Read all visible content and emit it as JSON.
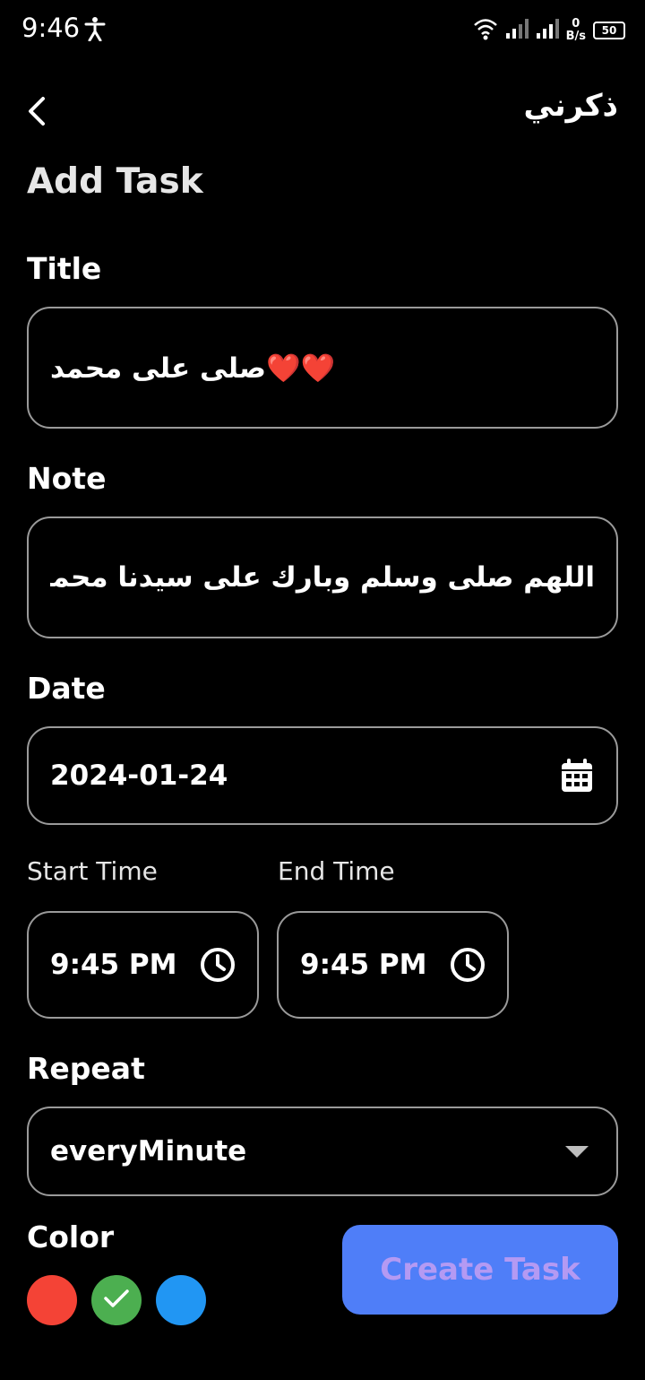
{
  "status_bar": {
    "time": "9:46",
    "net_speed_value": "0",
    "net_speed_unit": "B/s",
    "battery": "50"
  },
  "header": {
    "app_title": "ذكرني",
    "page_title": "Add Task"
  },
  "form": {
    "title_label": "Title",
    "title_value": "❤️❤️صلى على محمد",
    "note_label": "Note",
    "note_value": "اللهم صلى وسلم وبارك على سيدنا محمد",
    "date_label": "Date",
    "date_value": "2024-01-24",
    "start_time_label": "Start Time",
    "start_time_value": "9:45 PM",
    "end_time_label": "End Time",
    "end_time_value": "9:45 PM",
    "repeat_label": "Repeat",
    "repeat_value": "everyMinute",
    "color_label": "Color",
    "colors": [
      "#f44336",
      "#4caf50",
      "#2196f3"
    ],
    "selected_color_index": 1
  },
  "actions": {
    "create_label": "Create Task"
  },
  "icons": [
    "accessibility-icon",
    "wifi-icon",
    "signal-icon",
    "battery-icon",
    "back-icon",
    "calendar-icon",
    "clock-icon",
    "dropdown-arrow-icon",
    "check-icon"
  ]
}
